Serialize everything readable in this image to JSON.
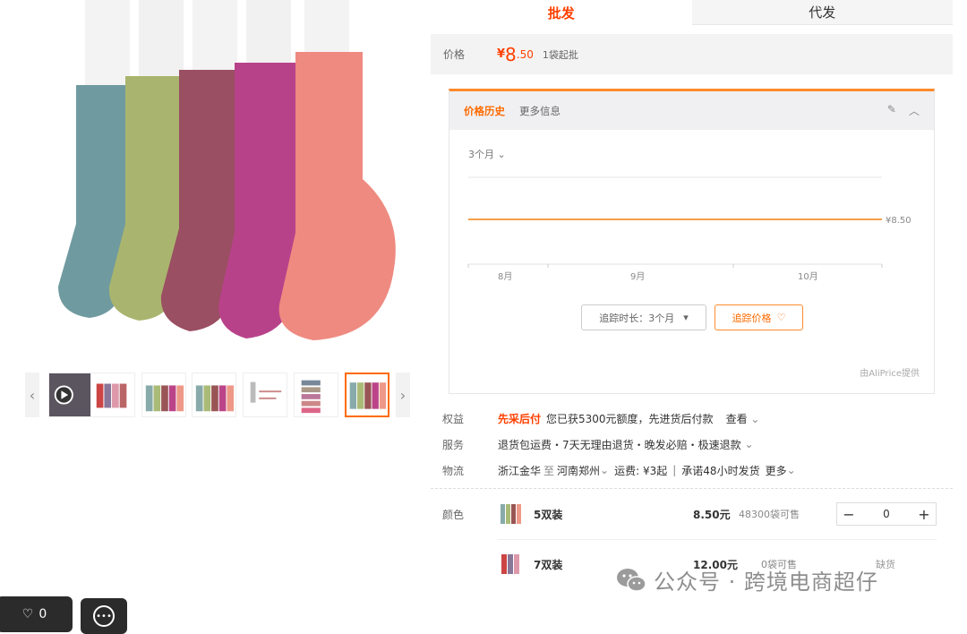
{
  "tabs": {
    "wholesale": "批发",
    "dropship": "代发"
  },
  "price": {
    "label": "价格",
    "yen": "¥",
    "int": "8",
    "dec": ".50",
    "note": "1袋起批"
  },
  "history": {
    "tab_active": "价格历史",
    "tab_more": "更多信息",
    "range": "3个月",
    "price_label": "¥8.50",
    "months": [
      "8月",
      "9月",
      "10月"
    ],
    "track_duration": "追踪时长：3个月",
    "track_button": "追踪价格",
    "provider": "由AliPrice提供"
  },
  "rights": {
    "label": "权益",
    "highlight": "先采后付",
    "text": "您已获5300元额度，先进货后付款",
    "more": "查看"
  },
  "service": {
    "label": "服务",
    "text": "退货包运费・7天无理由退货・晚发必赔・极速退款"
  },
  "logistics": {
    "label": "物流",
    "from": "浙江金华",
    "to_word": "至",
    "to": "河南郑州",
    "fee": "运费: ¥3起",
    "promise": "承诺48小时发货",
    "more": "更多"
  },
  "color": {
    "label": "颜色",
    "skus": [
      {
        "name": "5双装",
        "price": "8.50元",
        "stock": "48300袋可售",
        "qty": "0"
      },
      {
        "name": "7双装",
        "price": "12.00元",
        "stock": "0袋可售",
        "status": "缺货"
      }
    ]
  },
  "bottom": {
    "likes": "0"
  },
  "watermark": {
    "text": "公众号 · 跨境电商超仔"
  },
  "colors": {
    "accent": "#ff4000",
    "orange": "#ff8a2b",
    "price_line": "#f5a04a"
  }
}
